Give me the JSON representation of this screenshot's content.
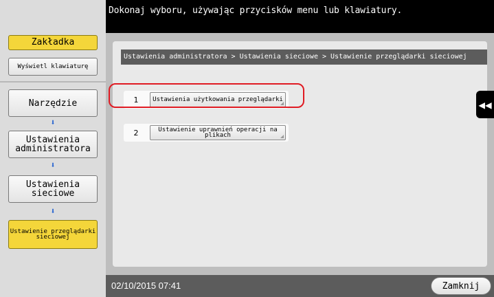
{
  "header": {
    "instruction": "Dokonaj wyboru, używając przycisków menu lub klawiatury."
  },
  "sidebar": {
    "bookmark_tab": "Zakładka",
    "show_keyboard": "Wyświetl klawiaturę",
    "nav": [
      {
        "label": "Narzędzie"
      },
      {
        "label": "Ustawienia administratora"
      },
      {
        "label": "Ustawienia sieciowe"
      },
      {
        "label": "Ustawienie przeglądarki sieciowej"
      }
    ]
  },
  "breadcrumb": "Ustawienia administratora > Ustawienia sieciowe > Ustawienie przeglądarki sieciowej",
  "options": [
    {
      "number": "1",
      "label": "Ustawienia użytkowania przeglądarki"
    },
    {
      "number": "2",
      "label": "Ustawienie uprawnień operacji na plikach"
    }
  ],
  "side_handle": "◀◀",
  "status": {
    "datetime": "02/10/2015  07:41",
    "close": "Zamknij"
  },
  "colors": {
    "highlight": "#e01a22",
    "selected": "#f4d63a",
    "arrow": "#1f5fd0"
  }
}
